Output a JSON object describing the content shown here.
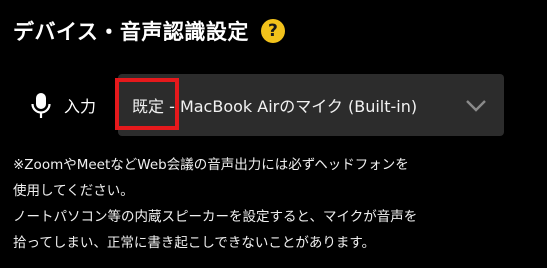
{
  "header": {
    "title": "デバイス・音声認識設定",
    "help_symbol": "?"
  },
  "audio_input": {
    "label": "入力",
    "selected_device": "既定 - MacBook Airのマイク (Built-in)"
  },
  "notice": {
    "lines": [
      "※ZoomやMeetなどWeb会議の音声出力には必ずヘッドフォンを",
      "使用してください。",
      "ノートパソコン等の内蔵スピーカーを設定すると、マイクが音声を",
      "拾ってしまい、正常に書き起こしできないことがあります。"
    ]
  },
  "colors": {
    "background": "#000000",
    "select_background": "#2c2c2c",
    "help_icon": "#f2c21b",
    "highlight_box": "#e5191c"
  },
  "icons": {
    "help": "help-icon",
    "microphone": "microphone-icon",
    "dropdown": "chevron-down-icon"
  }
}
